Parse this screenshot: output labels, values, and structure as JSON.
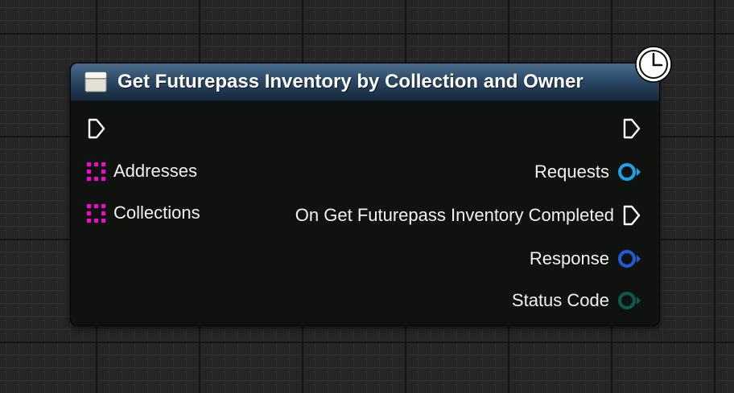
{
  "node": {
    "title": "Get Futurepass Inventory by Collection and Owner",
    "header_icon": "function-node-icon",
    "badge_icon": "clock-icon",
    "header_color": "#2c4a67",
    "inputs": [
      {
        "type": "exec",
        "icon": "exec-pin-icon"
      },
      {
        "label": "Addresses",
        "type": "string-array",
        "color": "#ff00d4",
        "icon": "array-pin-icon"
      },
      {
        "label": "Collections",
        "type": "string-array",
        "color": "#ff00d4",
        "icon": "array-pin-icon"
      }
    ],
    "outputs": [
      {
        "type": "exec",
        "icon": "exec-pin-icon"
      },
      {
        "label": "Requests",
        "type": "object",
        "color": "#1aa5e8",
        "icon": "data-pin-icon"
      },
      {
        "label": "On Get Futurepass Inventory Completed",
        "type": "exec",
        "icon": "exec-pin-icon"
      },
      {
        "label": "Response",
        "type": "object",
        "color": "#1f5ed9",
        "icon": "data-pin-icon"
      },
      {
        "label": "Status Code",
        "type": "byte",
        "color": "#0e5a50",
        "icon": "data-pin-icon"
      }
    ]
  }
}
